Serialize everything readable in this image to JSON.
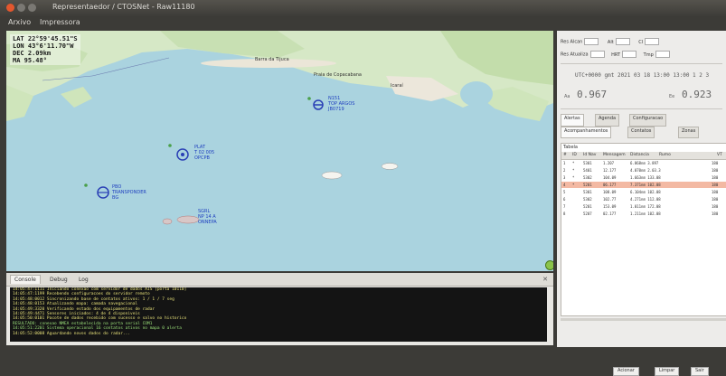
{
  "window": {
    "title": "Representaedor / CTOSNet - Raw11180"
  },
  "menu": [
    "Arxivo",
    "Impressora"
  ],
  "map": {
    "coords": [
      "LAT 22°59'45.51\"S",
      "LON 43°6'11.70\"W",
      "DEC  2.09km",
      "MA 95.48°"
    ],
    "city_labels": [
      "Barra da Tijuca",
      "Praia de Copacabana",
      "Icaraí"
    ],
    "contacts": [
      {
        "id": "c1",
        "lines": [
          "N151",
          "TOP ARGOS",
          "JB0719"
        ]
      },
      {
        "id": "c2",
        "lines": [
          "PLAT",
          "T 02 005",
          "OPCPB"
        ]
      },
      {
        "id": "c3",
        "lines": [
          "PBO",
          "TRANSPONDER",
          "BG"
        ]
      },
      {
        "id": "c4",
        "lines": [
          "SGRL",
          "NP 14 A",
          "ONNEPA"
        ]
      }
    ]
  },
  "bottom": {
    "tabs": [
      "Console",
      "Debug",
      "Log"
    ],
    "console_lines": [
      "14:05:47:1111  Iniciando conexao com servidor de dados AIS [porta 10110]",
      "14:05:47:1199  Recebendo configuracoes do servidor remoto",
      "14:05:48:0012  Sincronizando base de contatos ativos: 1 / 1 / 7 seg",
      "14:05:48:0153  Atualizando mapa: camada navegacional",
      "14:05:49:3320  Verificando estado dos equipamentos de radar",
      "14:05:49:4471  Sensores iniciados: 4 de 4 disponiveis",
      "14:05:50:0101  Pacote de dados recebido com sucesso e salvo no historico",
      "RESULTADO: conexao NMEA estabelecida na porta serial COM1",
      "14:05:51:2201  Sistema operacional 16 contatos ativos no mapa 0 alerta",
      "14:05:52:0008  Aguardando novos dados do radar..."
    ]
  },
  "right": {
    "row1": [
      "Res Alcan",
      "Alt",
      "Cl"
    ],
    "row2": [
      "Res Atualiza",
      "HRT",
      "Tmp"
    ],
    "utc": "UTC+0000  gmt  2021 03 18  13:00 13:00 1 2 3",
    "clocks": [
      {
        "tag": "Aa",
        "value": "0.967"
      },
      {
        "tag": "Ee",
        "value": "0.923"
      }
    ],
    "tabs": [
      "Alertas",
      "Agenda",
      "Configuracao"
    ],
    "subtabs": [
      "Acompanhamentos",
      "Contatos",
      "Zonas"
    ],
    "table_label": "Tabela",
    "columns": [
      "#",
      "ID",
      "Id Nav",
      "Mensagem",
      "Distancia",
      "Rumo",
      "VT"
    ],
    "rows": [
      [
        "1",
        "*",
        "5301",
        "1.207",
        "6.868nm  3.897",
        "180"
      ],
      [
        "2",
        "*",
        "5401",
        "12.177",
        "4.070nm  2.03.3",
        "180"
      ],
      [
        "3",
        "*",
        "5302",
        "104.09",
        "1.663nm  133.08",
        "180"
      ],
      [
        "4",
        "*",
        "5201",
        "06.177",
        "7.371nm  102.08",
        "180"
      ],
      [
        "5",
        "",
        "5301",
        "108.09",
        "6.104nm  102.08",
        "180"
      ],
      [
        "6",
        "",
        "5302",
        "102.77",
        "4.271nm  112.08",
        "180"
      ],
      [
        "7",
        "",
        "5201",
        "153.09",
        "1.011nm  172.08",
        "180"
      ],
      [
        "8",
        "",
        "5207",
        "02.177",
        "1.211nm  102.08",
        "180"
      ]
    ],
    "buttons": [
      "Acionar",
      "Limpar",
      "Sair"
    ]
  }
}
